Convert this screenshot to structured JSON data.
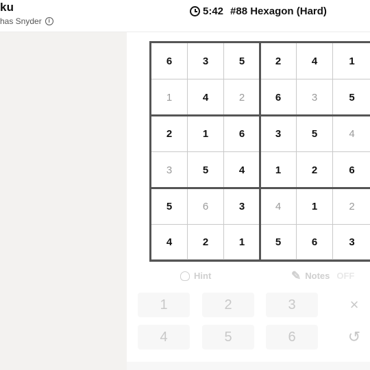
{
  "header": {
    "app_title": "ku",
    "author": "has Snyder",
    "timer": "5:42",
    "puzzle_title": "#88 Hexagon (Hard)"
  },
  "board": {
    "rows": [
      [
        {
          "v": "6",
          "t": "given"
        },
        {
          "v": "3",
          "t": "given"
        },
        {
          "v": "5",
          "t": "given"
        },
        {
          "v": "2",
          "t": "given"
        },
        {
          "v": "4",
          "t": "given"
        },
        {
          "v": "1",
          "t": "given"
        }
      ],
      [
        {
          "v": "1",
          "t": "user"
        },
        {
          "v": "4",
          "t": "given"
        },
        {
          "v": "2",
          "t": "user"
        },
        {
          "v": "6",
          "t": "given"
        },
        {
          "v": "3",
          "t": "user"
        },
        {
          "v": "5",
          "t": "given"
        }
      ],
      [
        {
          "v": "2",
          "t": "given"
        },
        {
          "v": "1",
          "t": "given"
        },
        {
          "v": "6",
          "t": "given"
        },
        {
          "v": "3",
          "t": "given"
        },
        {
          "v": "5",
          "t": "given"
        },
        {
          "v": "4",
          "t": "user"
        }
      ],
      [
        {
          "v": "3",
          "t": "user"
        },
        {
          "v": "5",
          "t": "given"
        },
        {
          "v": "4",
          "t": "given"
        },
        {
          "v": "1",
          "t": "given"
        },
        {
          "v": "2",
          "t": "given"
        },
        {
          "v": "6",
          "t": "given"
        }
      ],
      [
        {
          "v": "5",
          "t": "given"
        },
        {
          "v": "6",
          "t": "user"
        },
        {
          "v": "3",
          "t": "given"
        },
        {
          "v": "4",
          "t": "user"
        },
        {
          "v": "1",
          "t": "given"
        },
        {
          "v": "2",
          "t": "user"
        }
      ],
      [
        {
          "v": "4",
          "t": "given"
        },
        {
          "v": "2",
          "t": "given"
        },
        {
          "v": "1",
          "t": "given"
        },
        {
          "v": "5",
          "t": "given"
        },
        {
          "v": "6",
          "t": "given"
        },
        {
          "v": "3",
          "t": "given"
        }
      ]
    ]
  },
  "controls": {
    "hint_label": "Hint",
    "notes_label": "Notes",
    "notes_state": "OFF",
    "numbers": [
      "1",
      "2",
      "3",
      "4",
      "5",
      "6"
    ],
    "erase_icon": "×",
    "undo_icon": "↺"
  },
  "colors": {
    "given": "#111111",
    "user_entry": "#9a9a9a",
    "box_border": "#555555"
  }
}
